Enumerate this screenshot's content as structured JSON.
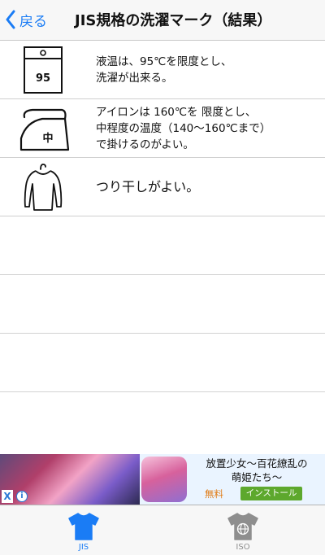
{
  "nav": {
    "back_label": "戻る",
    "title": "JIS規格の洗濯マーク（結果）"
  },
  "symbols": [
    {
      "icon": "washtub-icon",
      "symbol_text": "95",
      "text": "液温は、95℃を限度とし、\n洗濯が出来る。"
    },
    {
      "icon": "iron-icon",
      "symbol_text": "中",
      "text": "アイロンは 160℃を 限度とし、\n中程度の温度（140〜160℃まで）\nで掛けるのがよい。"
    },
    {
      "icon": "hang-dry-shirt-icon",
      "symbol_text": "",
      "text": "つり干しがよい。"
    }
  ],
  "ad": {
    "title": "放置少女〜百花繚乱の\n萌姫たち〜",
    "price": "無料",
    "install_label": "インストール",
    "close_glyph": "X",
    "info_glyph": "i"
  },
  "tabs": [
    {
      "label": "JIS",
      "icon": "shirt-icon",
      "selected": true,
      "color": "#1a7cf5"
    },
    {
      "label": "ISO",
      "icon": "shirt-globe-icon",
      "selected": false,
      "color": "#8e8e8e"
    }
  ],
  "colors": {
    "accent": "#1a7cf5",
    "install_button": "#5da82d",
    "price": "#e07a13"
  }
}
